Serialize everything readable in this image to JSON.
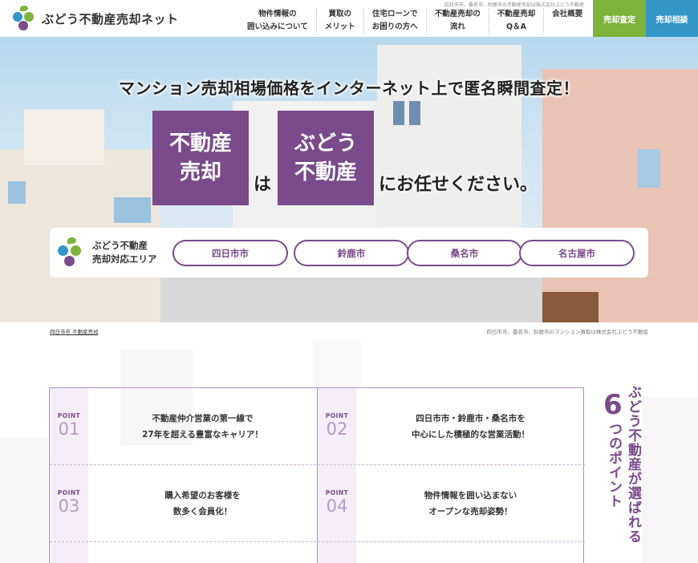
{
  "header": {
    "logo_text": "ぶどう不動産売却ネット",
    "tagline": "四日市市、桑名市、鈴鹿市の不動産売却は株式会社ぶどう不動産",
    "nav": [
      {
        "line1": "物件情報の",
        "line2": "囲い込みについて"
      },
      {
        "line1": "買取の",
        "line2": "メリット"
      },
      {
        "line1": "住宅ローンで",
        "line2": "お困りの方へ"
      },
      {
        "line1": "不動産売却の",
        "line2": "流れ"
      },
      {
        "line1": "不動産売却",
        "line2": "Q＆A"
      },
      {
        "line1": "会社概要",
        "line2": ""
      }
    ],
    "btn_sell": "売却査定",
    "btn_consult": "売却相談"
  },
  "hero": {
    "headline": "マンション売却相場価格をインターネット上で匿名瞬間査定！",
    "box1_line1": "不動産",
    "box1_line2": "売却",
    "word_wa": "は",
    "box2_line1": "ぶどう",
    "box2_line2": "不動産",
    "word_tail": "にお任せください。",
    "area_title_line1": "ぶどう不動産",
    "area_title_line2": "売却対応エリア",
    "areas": [
      "四日市市",
      "鈴鹿市",
      "桑名市",
      "名古屋市"
    ]
  },
  "subbar": {
    "breadcrumb": "四日市市 不動産売却",
    "tag": "四日市市、桑名市、鈴鹿市のマンション買取は株式会社ぶどう不動産"
  },
  "points": [
    {
      "label": "POINT",
      "num": "01",
      "line1": "不動産仲介営業の第一線で",
      "line2": "27年を超える豊富なキャリア！"
    },
    {
      "label": "POINT",
      "num": "02",
      "line1": "四日市市・鈴鹿市・桑名市を",
      "line2": "中心にした積極的な営業活動！"
    },
    {
      "label": "POINT",
      "num": "03",
      "line1": "購入希望のお客様を",
      "line2": "数多く会員化！"
    },
    {
      "label": "POINT",
      "num": "04",
      "line1": "物件情報を囲い込まない",
      "line2": "オープンな売却姿勢！"
    }
  ],
  "side_title": {
    "col1_pre": "ぶどう不動産が選ばれる",
    "num": "6",
    "col2": "つのポイント"
  },
  "colors": {
    "purple": "#7a4a8b",
    "green": "#7db33b",
    "blue": "#3296c8"
  }
}
